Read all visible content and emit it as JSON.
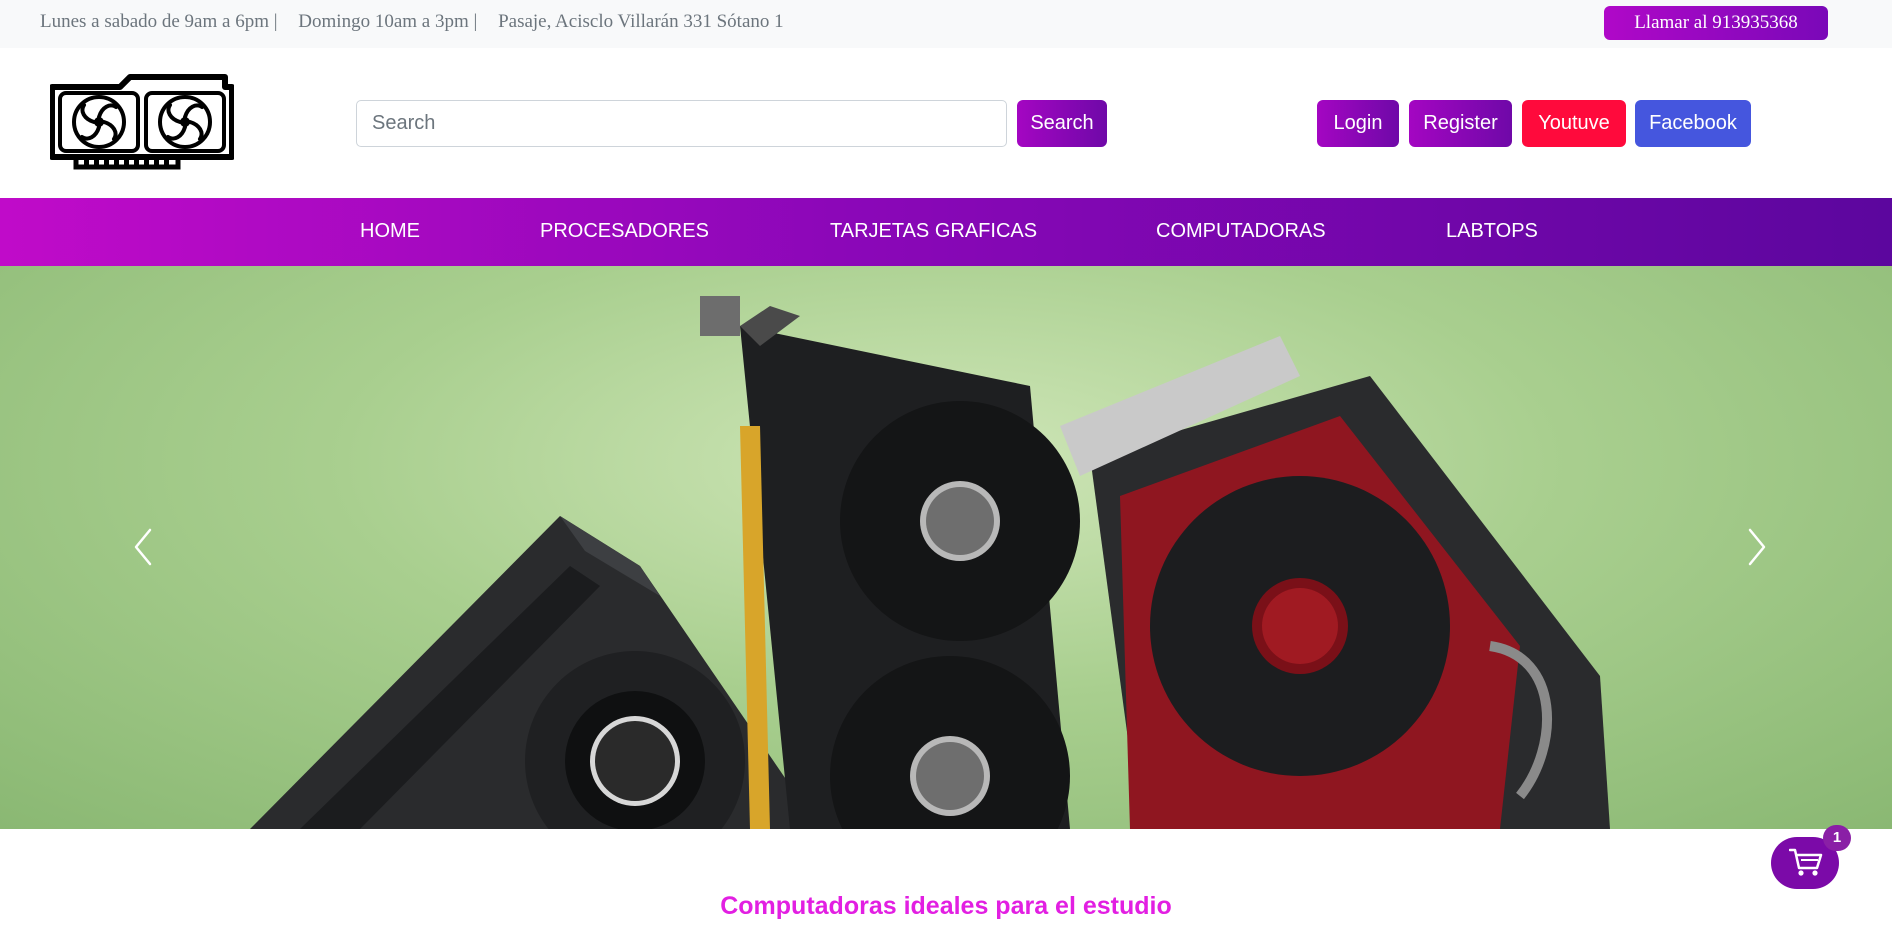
{
  "topbar": {
    "hours_weekday": "Lunes a sabado de 9am a 6pm |",
    "hours_sunday": "Domingo 10am a 3pm |",
    "address": "Pasaje, Acisclo Villarán 331 Sótano 1",
    "call_button": "Llamar al 913935368"
  },
  "header": {
    "logo_icon": "graphics-card-icon",
    "search_placeholder": "Search",
    "search_button": "Search",
    "login_button": "Login",
    "register_button": "Register",
    "youtube_button": "Youtuve",
    "facebook_button": "Facebook"
  },
  "nav": {
    "items": [
      "HOME",
      "PROCESADORES",
      "TARJETAS GRAFICAS",
      "COMPUTADORAS",
      "LABTOPS"
    ]
  },
  "carousel": {
    "prev_icon": "chevron-left-icon",
    "next_icon": "chevron-right-icon"
  },
  "section": {
    "title": "Computadoras ideales para el estudio"
  },
  "cart": {
    "icon": "shopping-cart-icon",
    "count": "1"
  },
  "colors": {
    "brand_purple": "#a406c2",
    "brand_dark_purple": "#5c069e",
    "youtube_red": "#ff0a3c",
    "facebook_blue": "#4556de",
    "title_magenta": "#e21fe2"
  }
}
